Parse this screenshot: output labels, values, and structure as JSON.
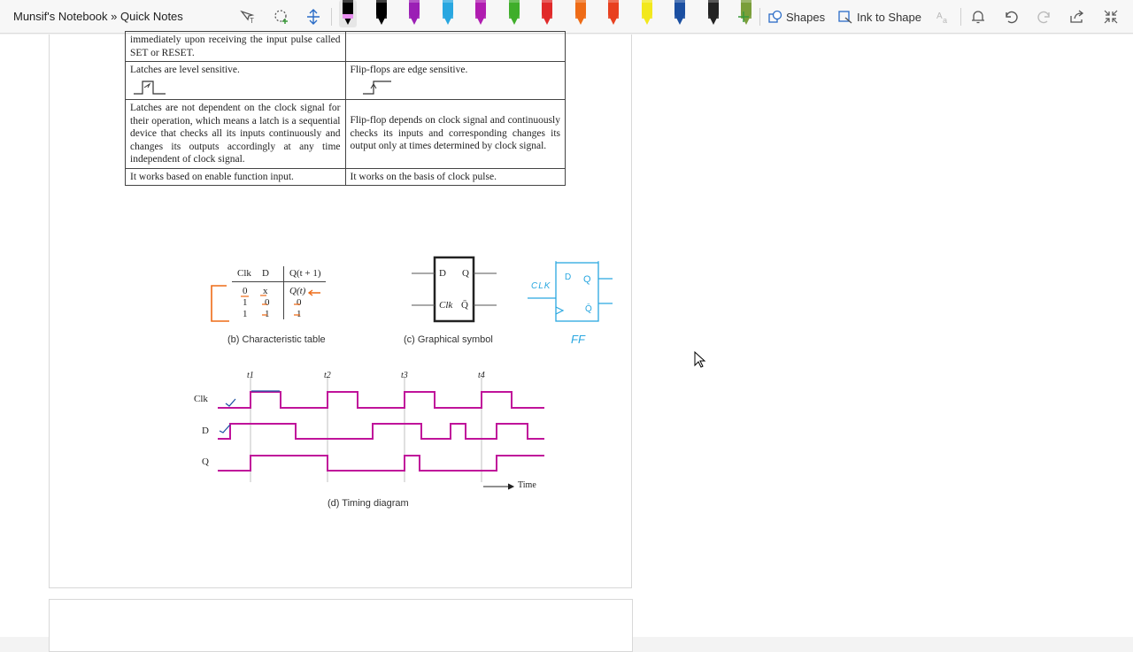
{
  "toolbar": {
    "breadcrumb": "Munsif's Notebook » Quick Notes",
    "shapes_label": "Shapes",
    "ink_to_shape_label": "Ink to Shape",
    "pens": [
      {
        "color": "#000000",
        "tip": "#e98ff0",
        "selected": true
      },
      {
        "color": "#000000"
      },
      {
        "color": "#9b1fb5"
      },
      {
        "color": "#29a7e0"
      },
      {
        "color": "#b01cb0"
      },
      {
        "color": "#3fae2a"
      },
      {
        "color": "#e02a2a"
      },
      {
        "color": "#ee6b16"
      },
      {
        "color": "#e8401f"
      },
      {
        "color": "#f2e81c"
      },
      {
        "color": "#1b4fa1"
      },
      {
        "color": "#222222"
      },
      {
        "color": "#7a9e3a"
      }
    ]
  },
  "comparison": {
    "row0": {
      "left": "immediately upon receiving the input pulse called SET or RESET.",
      "right": ""
    },
    "row1": {
      "left": "Latches are level sensitive.",
      "right": "Flip-flops are edge sensitive."
    },
    "row2": {
      "left": "Latches are not dependent on the clock signal for their operation, which means a latch is a sequential device that checks all its inputs continuously and changes its outputs accordingly at any time independent of clock signal.",
      "right": "Flip-flop depends on clock signal and continuously checks its inputs and corresponding changes its output only at times determined by clock signal."
    },
    "row3": {
      "left": "It works based on enable function input.",
      "right": "It works on the basis of clock pulse."
    }
  },
  "char_table": {
    "headers": [
      "Clk",
      "D",
      "Q(t + 1)"
    ],
    "rows": [
      [
        "0",
        "x",
        "Q(t)"
      ],
      [
        "1",
        "0",
        "0"
      ],
      [
        "1",
        "1",
        "1"
      ]
    ],
    "caption": "(b) Characteristic table"
  },
  "symbol": {
    "d": "D",
    "q": "Q",
    "clk": "Clk",
    "qbar": "Q̄",
    "caption": "(c) Graphical symbol"
  },
  "handwriting": {
    "ff_label": "FF",
    "clk_label": "CLK",
    "d": "D",
    "q": "Q",
    "qbar": "Q̄",
    "color": "#29a7e0"
  },
  "timing": {
    "signals": [
      "Clk",
      "D",
      "Q"
    ],
    "markers": [
      "t1",
      "t2",
      "t3",
      "t4"
    ],
    "time_label": "Time",
    "caption": "(d) Timing diagram",
    "wave_color": "#c0139a"
  }
}
